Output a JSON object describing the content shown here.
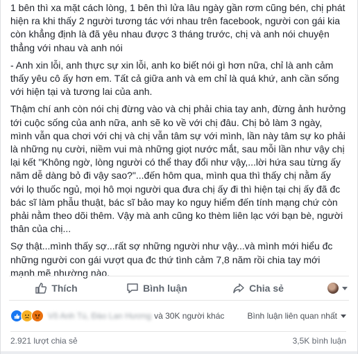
{
  "post": {
    "paragraphs": [
      "1 bên thì xa mặt cách lòng, 1 bên thì lửa lâu ngày gần rơm cũng bén, chị phát hiện ra khi thấy 2 người tương tác với nhau trên facebook, người con gái kia còn khẳng định là đã yêu nhau được 3 tháng trước, chị và anh nói chuyện thẳng với nhau và anh nói",
      "- Anh xin lỗi, anh thực sự xin lỗi, anh ko biết nói gì hơn nữa, chỉ là anh cảm thấy yêu cô ấy hơn em. Tất cả giữa anh và em chỉ là quá khứ, anh cần sống với hiện tại và tương lai của anh.",
      "Thậm chí anh còn nói chị đừng vào và chị phải chia tay anh, đừng ảnh hưởng tới cuộc sống của anh nữa, anh sẽ ko về với chị đâu. Chị bỏ làm 3 ngày, mình vẫn qua chơi với chị và chị vẫn tâm sự với mình, lần này tâm sự ko phải là những nụ cười, niềm vui mà những giọt nước mắt, sau mỗi lần như vậy chị lại kết \"Không ngờ, lòng người có thể thay đổi như vậy,...lời hứa sau từng ấy năm dễ dàng bỏ đi vậy sao?\"...đến hôm qua, mình qua thì thấy chị nằm ấy với lọ thuốc ngủ, mọi hô mọi người qua đưa chị ấy đi thì hiện tại chị ấy đã đc bác sĩ làm phẫu thuật, bác sĩ bảo may ko nguy hiểm đến tính mạng chứ còn phải nằm theo dõi thêm. Vậy mà anh cũng ko thèm liên lạc với bạn bè, người thân của chị...",
      "Sợ thật...mình thấy sợ...rất sợ những người như vậy...và mình mới hiểu đc những người con gái vượt qua đc thứ tình cảm 7,8 năm rồi chia tay mới mạnh mẽ nhường nào."
    ]
  },
  "actions": {
    "like_label": "Thích",
    "comment_label": "Bình luận",
    "share_label": "Chia sẻ"
  },
  "reactions": {
    "names_blurred": "Võ Anh Tú, Đào Lan Hương",
    "count_text": "và 30K người khác",
    "sort_label": "Bình luận liên quan nhất"
  },
  "stats": {
    "shares": "2.921 lượt chia sẻ",
    "comments": "3,5K bình luận"
  },
  "colors": {
    "text": "#1d2129",
    "muted": "#606770",
    "like_blue": "#1877f2"
  },
  "icons": {
    "like": "thumbs-up-icon",
    "comment": "speech-bubble-icon",
    "share": "share-arrow-icon"
  }
}
